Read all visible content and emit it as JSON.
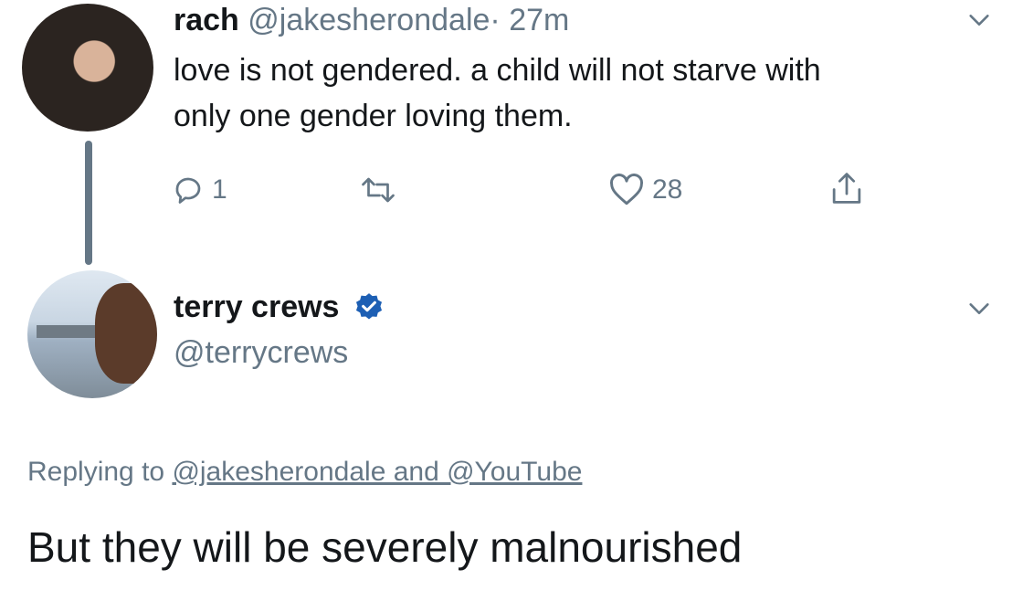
{
  "tweet1": {
    "name": "rach",
    "handle": "@jakesherondale",
    "time": "· 27m",
    "text_line1": "love is not gendered. a child will not starve with",
    "text_line2": "only one gender loving them.",
    "reply_count": "1",
    "like_count": "28"
  },
  "tweet2": {
    "name": "terry crews",
    "handle": "@terrycrews",
    "replying_prefix": "Replying to",
    "replying_mentions": "@jakesherondale and @YouTube",
    "text": "But they will be severely malnourished"
  },
  "icons": {
    "reply": "reply-icon",
    "retweet": "retweet-icon",
    "like": "heart-icon",
    "share": "share-icon",
    "verified": "verified-badge-icon",
    "caret": "chevron-down-icon"
  },
  "colors": {
    "text": "#14171a",
    "secondary": "#657786",
    "verified": "#1da1f2"
  }
}
